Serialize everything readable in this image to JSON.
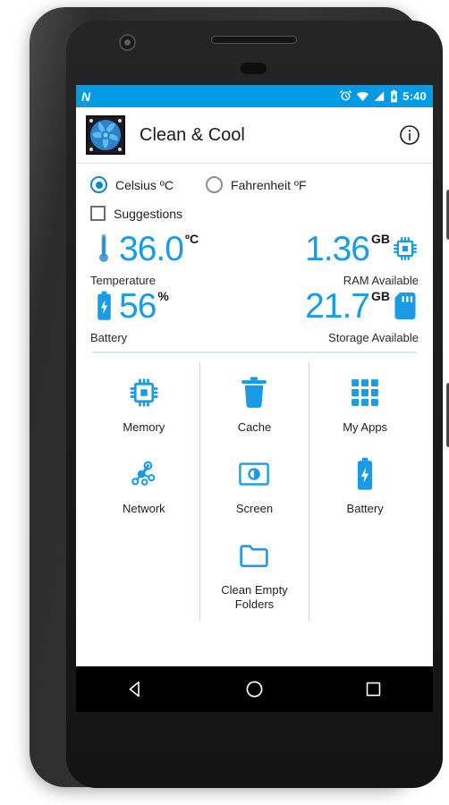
{
  "device": {
    "camera_icon": "front-camera",
    "speaker_icon": "earpiece-speaker",
    "sensor_icon": "proximity-sensor",
    "power_button": "power-button",
    "volume_button": "volume-button"
  },
  "status_bar": {
    "os_logo": "N",
    "time": "5:40",
    "icons": [
      "alarm-icon",
      "wifi-icon",
      "signal-icon",
      "battery-icon"
    ],
    "background_color": "#029ae5"
  },
  "app_bar": {
    "title": "Clean & Cool",
    "app_icon": "fan-icon",
    "info_icon": "info-icon"
  },
  "options": {
    "temperature_unit": {
      "celsius": {
        "label": "Celsius ºC",
        "selected": true
      },
      "fahrenheit": {
        "label": "Fahrenheit ºF",
        "selected": false
      }
    },
    "suggestions": {
      "label": "Suggestions",
      "checked": false
    }
  },
  "stats": [
    {
      "name": "temperature",
      "value": "36.0",
      "unit": "ºC",
      "label": "Temperature",
      "icon": "thermometer-icon",
      "align": "left"
    },
    {
      "name": "ram",
      "value": "1.36",
      "unit": "GB",
      "label": "RAM Available",
      "icon": "chip-icon",
      "align": "right"
    },
    {
      "name": "battery",
      "value": "56",
      "unit": "%",
      "label": "Battery",
      "icon": "battery-icon",
      "align": "left"
    },
    {
      "name": "storage",
      "value": "21.7",
      "unit": "GB",
      "label": "Storage Available",
      "icon": "sdcard-icon",
      "align": "right"
    }
  ],
  "actions": [
    {
      "label": "Memory",
      "icon": "chip-icon"
    },
    {
      "label": "Cache",
      "icon": "trash-icon"
    },
    {
      "label": "My Apps",
      "icon": "apps-grid-icon"
    },
    {
      "label": "Network",
      "icon": "network-nodes-icon"
    },
    {
      "label": "Screen",
      "icon": "brightness-icon"
    },
    {
      "label": "Battery",
      "icon": "battery-icon"
    },
    {
      "label": "Clean Empty Folders",
      "icon": "folder-icon"
    }
  ],
  "nav_bar": {
    "back": "back-triangle-icon",
    "home": "home-circle-icon",
    "recents": "recents-square-icon"
  },
  "colors": {
    "accent_blue": "#1b9ae6",
    "status_bar_blue": "#029ae5",
    "divider_blue": "#b9dcf5",
    "text_dark": "#1f1f1f"
  }
}
